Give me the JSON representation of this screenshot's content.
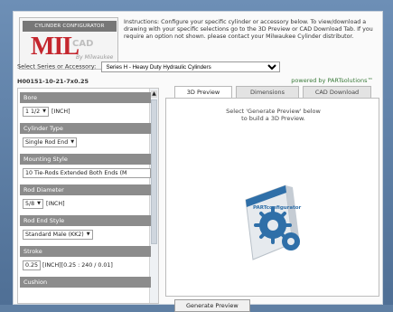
{
  "logo": {
    "banner": "CYLINDER CONFIGURATOR",
    "mil": "MIL",
    "cad": "CAD",
    "sub": "By Milwaukee"
  },
  "instructions": "Instructions: Configure your specific cylinder or accessory below. To view/download a drawing with your specific selections go to the 3D Preview or CAD Download Tab. If you require an option not shown. please contact your Milwaukee Cylinder distributor.",
  "series": {
    "label": "Select Series or Accessory:",
    "value": "Series H - Heavy Duty Hydraulic Cylinders"
  },
  "part_number": "H00151-10-21-7x0.25",
  "powered_by": "powered by PARTsolutions™",
  "config": {
    "bore": {
      "label": "Bore",
      "value": "1 1/2",
      "unit": "[INCH]"
    },
    "cylinder_type": {
      "label": "Cylinder Type",
      "value": "Single Rod End"
    },
    "mounting_style": {
      "label": "Mounting Style",
      "value": "10 Tie-Rods Extended Both Ends (M"
    },
    "rod_diameter": {
      "label": "Rod Diameter",
      "value": "5/8",
      "unit": "[INCH]"
    },
    "rod_end_style": {
      "label": "Rod End Style",
      "value": "Standard Male (KK2)"
    },
    "stroke": {
      "label": "Stroke",
      "value": "0.25",
      "range": "[INCH][0.25 : 240 / 0.01]"
    },
    "cushion": {
      "label": "Cushion"
    }
  },
  "tabs": [
    {
      "label": "3D Preview",
      "active": true
    },
    {
      "label": "Dimensions",
      "active": false
    },
    {
      "label": "CAD Download",
      "active": false
    }
  ],
  "preview": {
    "message_line1": "Select 'Generate Preview' below",
    "message_line2": "to build a 3D Preview.",
    "box_label": "PARTconfigurator"
  },
  "generate_button": "Generate Preview",
  "colors": {
    "accent_red": "#c4262e",
    "group_header": "#8c8c8c",
    "powered_green": "#3a7a3a",
    "gear_blue": "#2f6fa8"
  }
}
